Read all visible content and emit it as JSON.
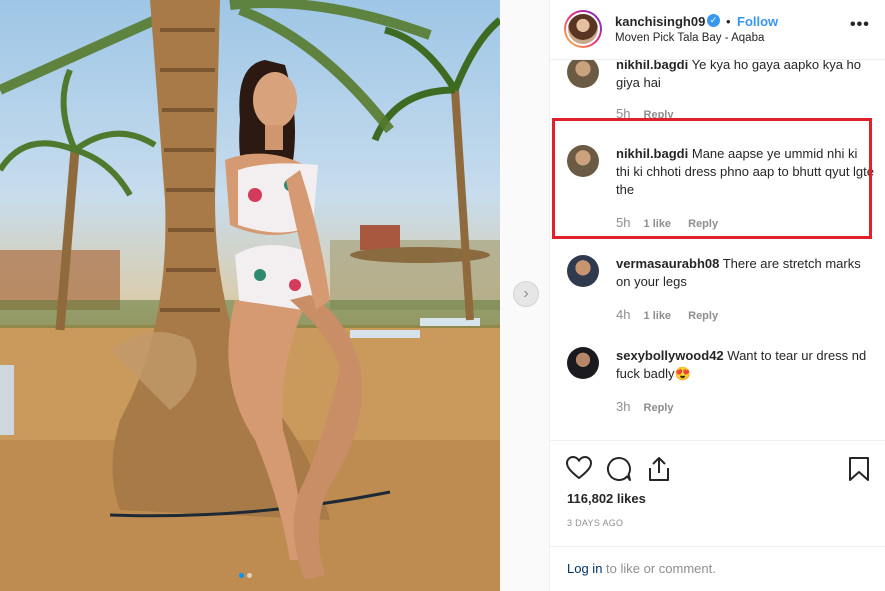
{
  "post": {
    "username": "kanchisingh09",
    "separator": "•",
    "follow_label": "Follow",
    "location": "Moven Pick Tala Bay - Aqaba",
    "more_label": "•••"
  },
  "comments": [
    {
      "username": "nikhil.bagdi",
      "text": "Ye kya ho gaya aapko kya ho giya hai",
      "time": "5h",
      "likes": "",
      "reply_label": "Reply"
    },
    {
      "username": "nikhil.bagdi",
      "text": "Mane aapse ye ummid nhi ki thi ki chhoti dress phno aap to bhutt qyut lgte the",
      "time": "5h",
      "likes": "1 like",
      "reply_label": "Reply"
    },
    {
      "username": "vermasaurabh08",
      "text": "There are stretch marks on your legs",
      "time": "4h",
      "likes": "1 like",
      "reply_label": "Reply"
    },
    {
      "username": "sexybollywood42",
      "text": "Want to tear ur dress nd fuck badly😍",
      "time": "3h",
      "likes": "",
      "reply_label": "Reply"
    }
  ],
  "actions": {
    "likes": "116,802 likes",
    "time_ago": "3 DAYS AGO",
    "login_link": "Log in",
    "login_suffix": " to like or comment."
  },
  "icons": {
    "verified": "verified-badge-icon",
    "like": "heart-icon",
    "comment": "comment-bubble-icon",
    "share": "share-icon",
    "save": "bookmark-icon",
    "next": "chevron-right-icon"
  },
  "colors": {
    "accent_blue": "#3897f0",
    "highlight_red": "#e0212b",
    "muted_text": "#8e8e8e"
  }
}
